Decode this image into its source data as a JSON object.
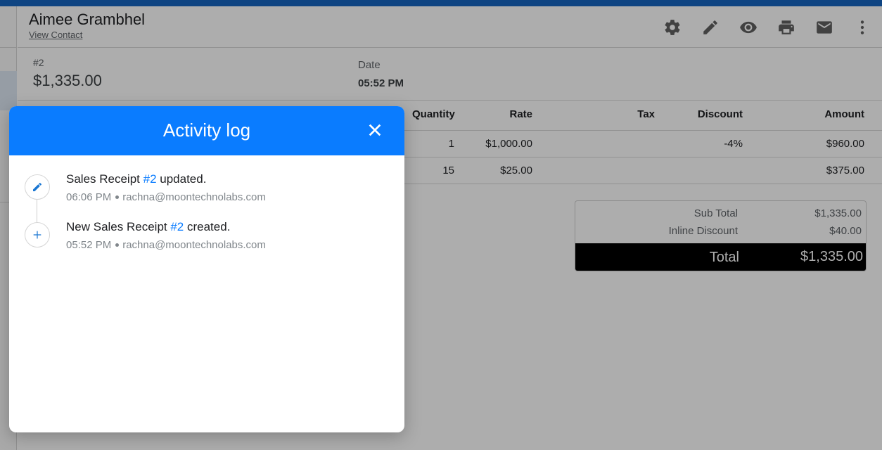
{
  "contact": {
    "name": "Aimee Grambhel",
    "link_label": "View Contact"
  },
  "toolbar": {
    "icons": [
      "gear-icon",
      "pencil-icon",
      "eye-icon",
      "printer-icon",
      "mail-icon",
      "more-vert-icon"
    ]
  },
  "receipt": {
    "number": "#2",
    "amount": "$1,335.00",
    "date_label": "Date",
    "date_value": "05:52 PM"
  },
  "items": {
    "headers": {
      "quantity": "Quantity",
      "rate": "Rate",
      "tax": "Tax",
      "discount": "Discount",
      "amount": "Amount"
    },
    "rows": [
      {
        "quantity": "1",
        "rate": "$1,000.00",
        "tax": "",
        "discount": "-4%",
        "amount": "$960.00"
      },
      {
        "quantity": "15",
        "rate": "$25.00",
        "tax": "",
        "discount": "",
        "amount": "$375.00"
      }
    ]
  },
  "totals": {
    "sub_total_label": "Sub Total",
    "sub_total_value": "$1,335.00",
    "inline_discount_label": "Inline Discount",
    "inline_discount_value": "$40.00",
    "total_label": "Total",
    "total_value": "$1,335.00"
  },
  "activity_log": {
    "title": "Activity log",
    "entries": [
      {
        "icon": "pencil-icon",
        "prefix": "Sales Receipt ",
        "ref": "#2",
        "suffix": " updated.",
        "time": "06:06 PM",
        "user": "rachna@moontechnolabs.com"
      },
      {
        "icon": "plus-icon",
        "prefix": "New Sales Receipt ",
        "ref": "#2",
        "suffix": " created.",
        "time": "05:52 PM",
        "user": "rachna@moontechnolabs.com"
      }
    ]
  },
  "colors": {
    "accent": "#0a7cff",
    "top_bar": "#1565c0",
    "total_bar": "#000000"
  }
}
